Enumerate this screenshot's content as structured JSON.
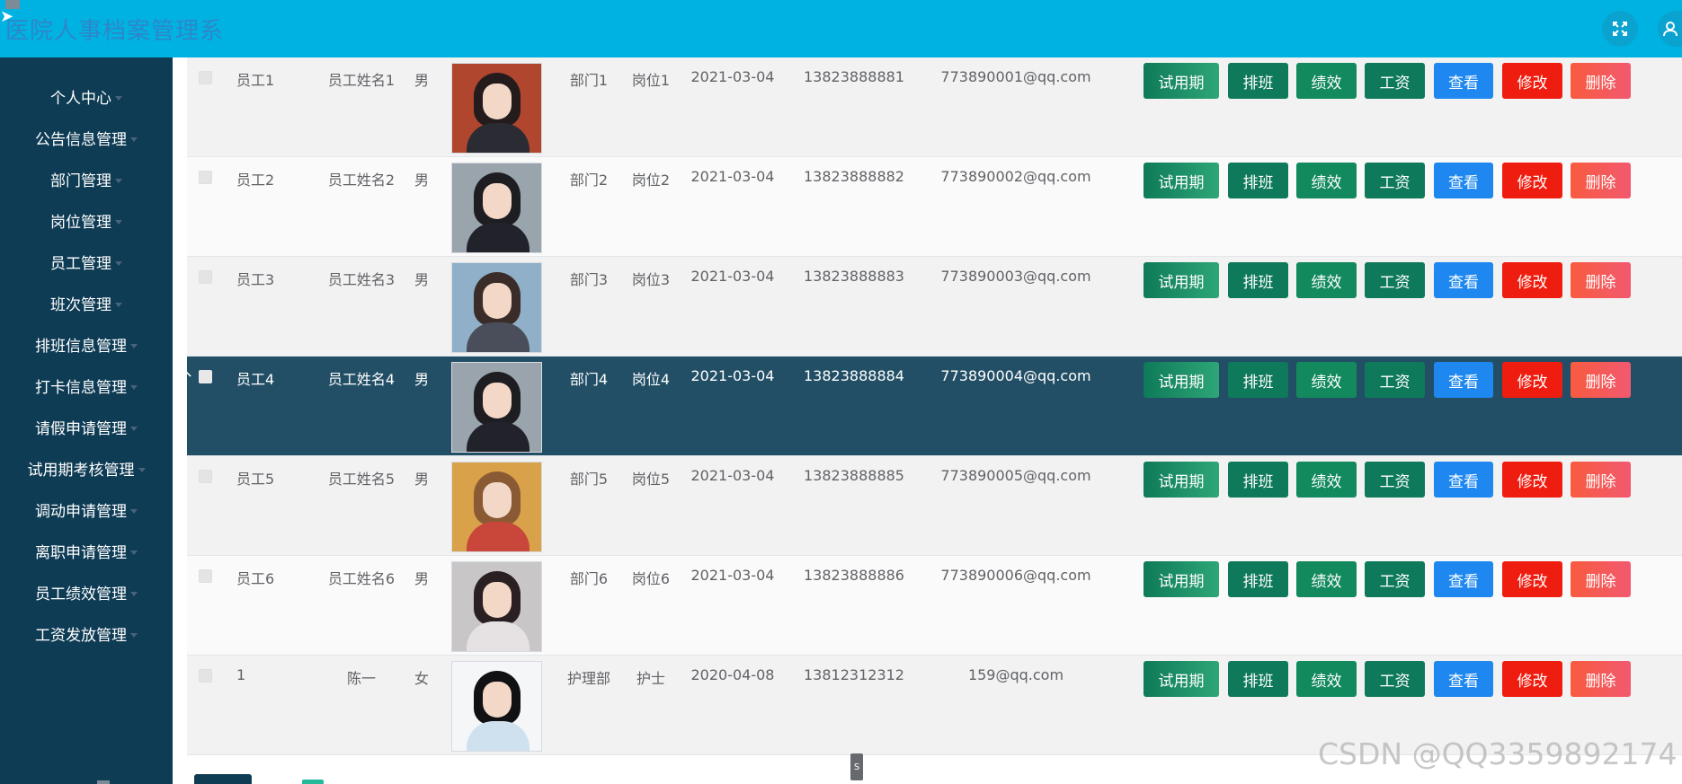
{
  "app": {
    "title": "医院人事档案管理系"
  },
  "sidebar": {
    "items": [
      {
        "label": "个人中心"
      },
      {
        "label": "公告信息管理"
      },
      {
        "label": "部门管理"
      },
      {
        "label": "岗位管理"
      },
      {
        "label": "员工管理"
      },
      {
        "label": "班次管理"
      },
      {
        "label": "排班信息管理"
      },
      {
        "label": "打卡信息管理"
      },
      {
        "label": "请假申请管理"
      },
      {
        "label": "试用期考核管理"
      },
      {
        "label": "调动申请管理"
      },
      {
        "label": "离职申请管理"
      },
      {
        "label": "员工绩效管理"
      },
      {
        "label": "工资发放管理"
      }
    ]
  },
  "actions": {
    "trial": "试用期",
    "schedule": "排班",
    "performance": "绩效",
    "wage": "工资",
    "view": "查看",
    "edit": "修改",
    "delete": "删除"
  },
  "rows": [
    {
      "id": "员工1",
      "name": "员工姓名1",
      "gender": "男",
      "dept": "部门1",
      "post": "岗位1",
      "date": "2021-03-04",
      "phone": "13823888881",
      "email": "773890001@qq.com",
      "photo_colors": [
        "#b1462f",
        "#241c1c",
        "#2b2b33"
      ]
    },
    {
      "id": "员工2",
      "name": "员工姓名2",
      "gender": "男",
      "dept": "部门2",
      "post": "岗位2",
      "date": "2021-03-04",
      "phone": "13823888882",
      "email": "773890002@qq.com",
      "photo_colors": [
        "#9aa4ad",
        "#1d1d22",
        "#22222a"
      ]
    },
    {
      "id": "员工3",
      "name": "员工姓名3",
      "gender": "男",
      "dept": "部门3",
      "post": "岗位3",
      "date": "2021-03-04",
      "phone": "13823888883",
      "email": "773890003@qq.com",
      "photo_colors": [
        "#8fb0c8",
        "#3a2c28",
        "#4a4e5a"
      ]
    },
    {
      "id": "员工4",
      "name": "员工姓名4",
      "gender": "男",
      "dept": "部门4",
      "post": "岗位4",
      "date": "2021-03-04",
      "phone": "13823888884",
      "email": "773890004@qq.com",
      "photo_colors": [
        "#9aa4ad",
        "#1d1d22",
        "#22222a"
      ]
    },
    {
      "id": "员工5",
      "name": "员工姓名5",
      "gender": "男",
      "dept": "部门5",
      "post": "岗位5",
      "date": "2021-03-04",
      "phone": "13823888885",
      "email": "773890005@qq.com",
      "photo_colors": [
        "#d9a24a",
        "#8a5a34",
        "#c9463b"
      ]
    },
    {
      "id": "员工6",
      "name": "员工姓名6",
      "gender": "男",
      "dept": "部门6",
      "post": "岗位6",
      "date": "2021-03-04",
      "phone": "13823888886",
      "email": "773890006@qq.com",
      "photo_colors": [
        "#c9c6c8",
        "#2a2022",
        "#e6e2e4"
      ]
    },
    {
      "id": "1",
      "name": "陈一",
      "gender": "女",
      "dept": "护理部",
      "post": "护士",
      "date": "2020-04-08",
      "phone": "13812312312",
      "email": "159@qq.com",
      "photo_colors": [
        "#f4f6f8",
        "#111114",
        "#cfe0ee"
      ]
    }
  ],
  "scroll_tag": "S",
  "watermark": "CSDN @QQ3359892174",
  "colors": {
    "header": "#00b2e2",
    "sidebar": "#0f3c55",
    "active_row": "#224f66"
  }
}
